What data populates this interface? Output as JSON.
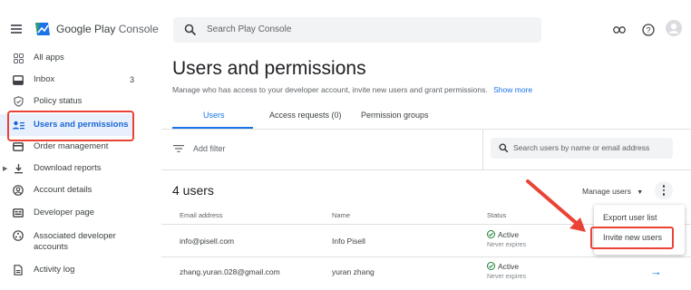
{
  "app": {
    "brand_primary": "Google Play",
    "brand_secondary": "Console"
  },
  "search": {
    "placeholder": "Search Play Console"
  },
  "sidebar": {
    "items": [
      {
        "label": "All apps",
        "icon": "grid-icon"
      },
      {
        "label": "Inbox",
        "count": "3",
        "icon": "inbox-icon"
      },
      {
        "label": "Policy status",
        "icon": "shield-icon"
      },
      {
        "label": "Users and permissions",
        "icon": "users-icon",
        "active": true
      },
      {
        "label": "Order management",
        "icon": "card-icon"
      },
      {
        "label": "Download reports",
        "icon": "download-icon"
      },
      {
        "label": "Account details",
        "icon": "account-icon"
      },
      {
        "label": "Developer page",
        "icon": "page-icon"
      },
      {
        "label": "Associated developer",
        "label2": "accounts",
        "icon": "link-icon"
      },
      {
        "label": "Activity log",
        "icon": "log-icon"
      }
    ]
  },
  "main": {
    "title": "Users and permissions",
    "subtitle": "Manage who has access to your developer account, invite new users and grant permissions.",
    "show_more": "Show more",
    "tabs": [
      {
        "label": "Users",
        "active": true
      },
      {
        "label": "Access requests (0)"
      },
      {
        "label": "Permission groups"
      }
    ],
    "filter_label": "Add filter",
    "user_search_placeholder": "Search users by name or email address",
    "count_label": "4 users",
    "manage_users": "Manage users",
    "columns": {
      "email": "Email address",
      "name": "Name",
      "status": "Status"
    },
    "rows": [
      {
        "email": "info@pisell.com",
        "name": "Info Pisell",
        "status": "Active",
        "expiry": "Never expires"
      },
      {
        "email": "zhang.yuran.028@gmail.com",
        "name": "yuran zhang",
        "status": "Active",
        "expiry": "Never expires"
      }
    ]
  },
  "menu": {
    "items": [
      "Export user list",
      "Invite new users"
    ]
  },
  "colors": {
    "accent": "#1a73e8",
    "active_bg": "#e8f0fe",
    "annotation": "#ea4335",
    "status_ok": "#188038"
  }
}
